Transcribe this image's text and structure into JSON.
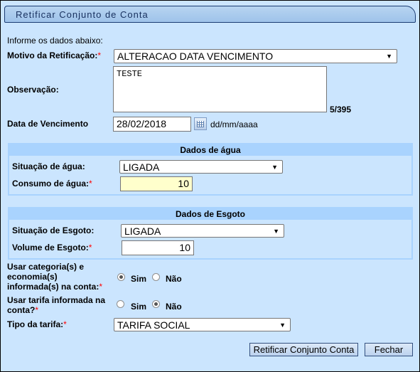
{
  "window": {
    "title": "Retificar Conjunto de Conta"
  },
  "form": {
    "intro": "Informe os dados abaixo:",
    "motivo": {
      "label": "Motivo da Retificação:",
      "required": "*",
      "value": "ALTERACAO DATA VENCIMENTO"
    },
    "observacao": {
      "label": "Observação:",
      "value": "TESTE",
      "counter": "5/395"
    },
    "vencimento": {
      "label": "Data de Vencimento",
      "value": "28/02/2018",
      "format": "dd/mm/aaaa"
    }
  },
  "agua": {
    "title": "Dados de água",
    "situacao": {
      "label": "Situação de água:",
      "value": "LIGADA"
    },
    "consumo": {
      "label": "Consumo de água:",
      "required": "*",
      "value": "10"
    }
  },
  "esgoto": {
    "title": "Dados de Esgoto",
    "situacao": {
      "label": "Situação de Esgoto:",
      "value": "LIGADA"
    },
    "volume": {
      "label": "Volume de Esgoto:",
      "required": "*",
      "value": "10"
    }
  },
  "categoria": {
    "label_lines": [
      "Usar categoria(s) e",
      "economia(s)",
      "informada(s) na conta:"
    ],
    "required": "*",
    "sim": "Sim",
    "nao": "Não",
    "selected": "Sim"
  },
  "tarifa": {
    "label_lines": [
      "Usar tarifa informada na",
      "conta?"
    ],
    "required": "*",
    "sim": "Sim",
    "nao": "Não",
    "selected": "Não"
  },
  "tipo_tarifa": {
    "label": "Tipo da tarifa:",
    "required": "*",
    "value": "TARIFA SOCIAL"
  },
  "buttons": {
    "submit": "Retificar Conjunto Conta",
    "close": "Fechar"
  },
  "colors": {
    "background": "#cbe5fe",
    "section_header": "#a9d3fe",
    "highlight_input": "#ffffcc"
  }
}
